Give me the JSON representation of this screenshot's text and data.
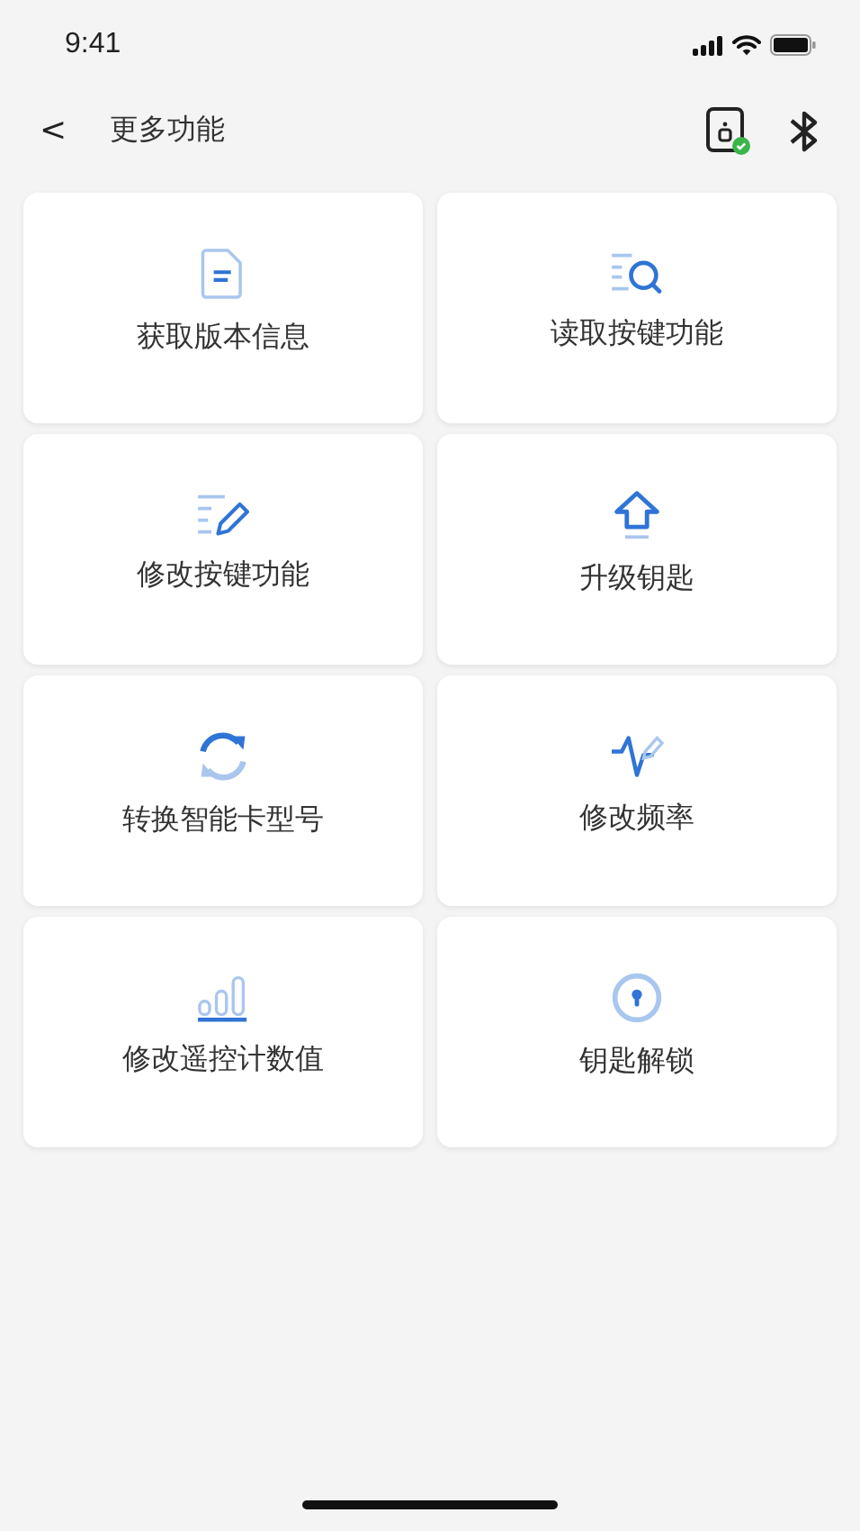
{
  "status_bar": {
    "time": "9:41"
  },
  "header": {
    "back": "<",
    "title": "更多功能"
  },
  "cards": [
    {
      "kind": "document",
      "label": "获取版本信息"
    },
    {
      "kind": "search-list",
      "label": "读取按键功能"
    },
    {
      "kind": "edit-list",
      "label": "修改按键功能"
    },
    {
      "kind": "upload",
      "label": "升级钥匙"
    },
    {
      "kind": "refresh",
      "label": "转换智能卡型号"
    },
    {
      "kind": "wave",
      "label": "修改频率"
    },
    {
      "kind": "bars",
      "label": "修改遥控计数值"
    },
    {
      "kind": "keyhole",
      "label": "钥匙解锁"
    }
  ]
}
